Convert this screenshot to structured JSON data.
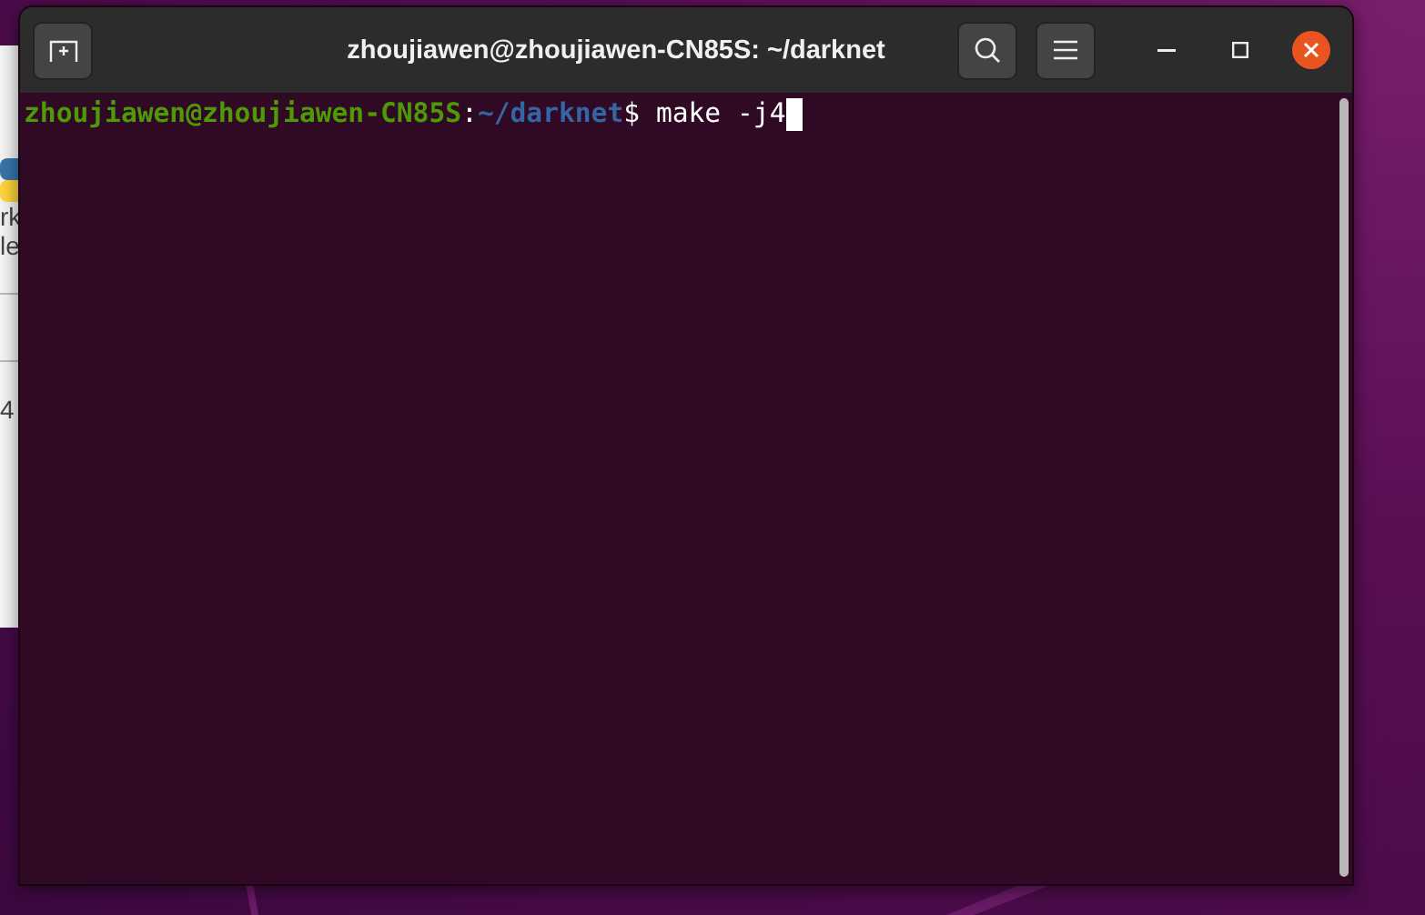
{
  "background_window": {
    "texts": [
      "rk",
      "le",
      "4"
    ]
  },
  "terminal": {
    "title": "zhoujiawen@zhoujiawen-CN85S: ~/darknet",
    "lines": [
      {
        "segments": [
          {
            "text": "zhoujiawen@zhoujiawen-CN85S",
            "kind": "user"
          },
          {
            "text": ":",
            "kind": "plain"
          },
          {
            "text": "~/darknet",
            "kind": "path"
          },
          {
            "text": "$ make -j4",
            "kind": "plain"
          }
        ],
        "cursor": true
      }
    ]
  }
}
